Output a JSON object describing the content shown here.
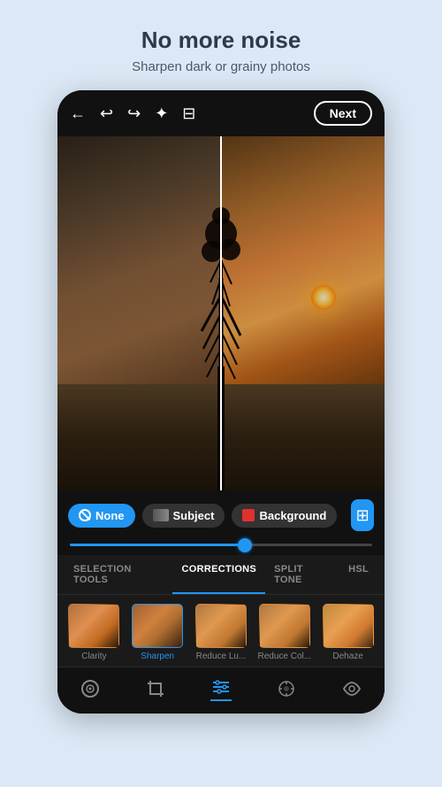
{
  "page": {
    "title": "No more noise",
    "subtitle": "Sharpen dark or grainy photos"
  },
  "toolbar": {
    "next_label": "Next"
  },
  "selection": {
    "none_label": "None",
    "subject_label": "Subject",
    "background_label": "Background"
  },
  "tabs": [
    {
      "id": "selection-tools",
      "label": "SELECTION TOOLS",
      "active": false
    },
    {
      "id": "corrections",
      "label": "CORRECTIONS",
      "active": true
    },
    {
      "id": "split-tone",
      "label": "SPLIT TONE",
      "active": false
    },
    {
      "id": "hsl",
      "label": "HSL",
      "active": false
    }
  ],
  "thumbnails": [
    {
      "id": "clarity",
      "label": "Clarity",
      "active": false
    },
    {
      "id": "sharpen",
      "label": "Sharpen",
      "active": true
    },
    {
      "id": "reduce-lu",
      "label": "Reduce Lu...",
      "active": false
    },
    {
      "id": "reduce-col",
      "label": "Reduce Col...",
      "active": false
    },
    {
      "id": "dehaze",
      "label": "Dehaze",
      "active": false
    }
  ],
  "bottom_nav": [
    {
      "id": "camera",
      "icon": "⊙",
      "active": false
    },
    {
      "id": "crop",
      "icon": "⊡",
      "active": false
    },
    {
      "id": "adjustments",
      "icon": "≡",
      "active": true
    },
    {
      "id": "healing",
      "icon": "✦",
      "active": false
    },
    {
      "id": "eye",
      "icon": "◉",
      "active": false
    }
  ],
  "icons": {
    "back": "←",
    "undo": "↩",
    "redo": "↪",
    "magic": "✦",
    "compare": "⊟",
    "layers": "⊞"
  }
}
